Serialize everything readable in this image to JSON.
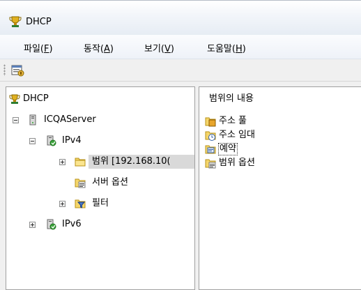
{
  "window": {
    "title": "DHCP"
  },
  "menu": [
    {
      "label": "파일",
      "accel": "F"
    },
    {
      "label": "동작",
      "accel": "A"
    },
    {
      "label": "보기",
      "accel": "V"
    },
    {
      "label": "도움말",
      "accel": "H"
    }
  ],
  "tree": {
    "root": "DHCP",
    "server": "ICQAServer",
    "ipv4": "IPv4",
    "scope": "범위 [192.168.10(",
    "server_options": "서버 옵션",
    "filter": "필터",
    "ipv6": "IPv6"
  },
  "content": {
    "header": "범위의 내용",
    "items": [
      "주소 풀",
      "주소 임대",
      "예약",
      "범위 옵션"
    ]
  }
}
